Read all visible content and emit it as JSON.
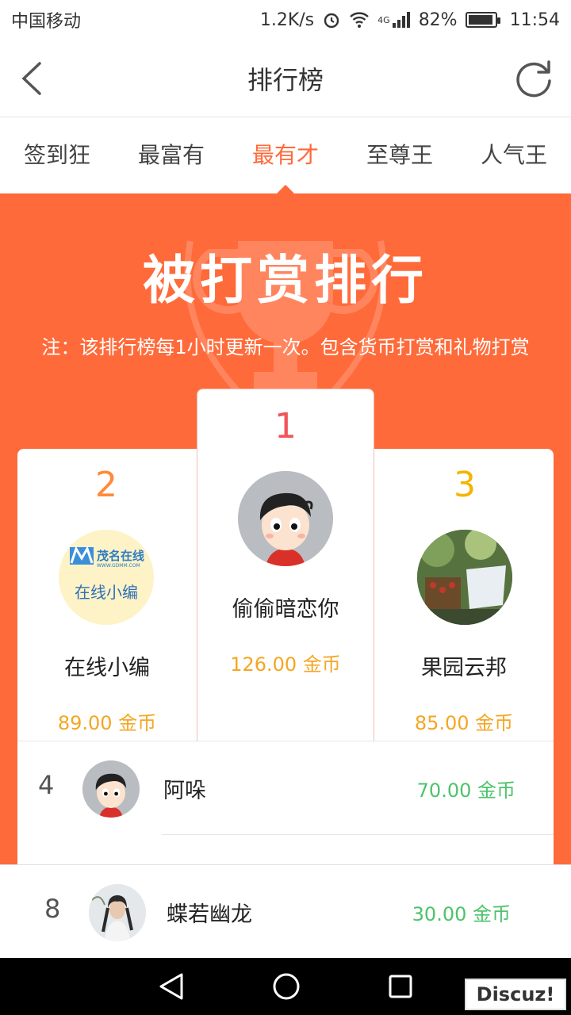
{
  "status_bar": {
    "carrier": "中国移动",
    "speed": "1.2K/s",
    "network": "4G",
    "battery": "82%",
    "battery_level": 0.82,
    "time": "11:54"
  },
  "header": {
    "title": "排行榜"
  },
  "tabs": [
    {
      "label": "签到狂",
      "active": false
    },
    {
      "label": "最富有",
      "active": false
    },
    {
      "label": "最有才",
      "active": true
    },
    {
      "label": "至尊王",
      "active": false
    },
    {
      "label": "人气王",
      "active": false
    }
  ],
  "banner": {
    "title": "被打赏排行",
    "note": "注：该排行榜每1小时更新一次。包含货币打赏和礼物打赏"
  },
  "podium": {
    "first": {
      "rank": "1",
      "name": "偷偷暗恋你",
      "score": "126.00 金币"
    },
    "second": {
      "rank": "2",
      "name": "在线小编",
      "score": "89.00 金币",
      "logo_text": "茂名在线",
      "logo_sub": "WWW.GDMM.COM",
      "logo_caption": "在线小编"
    },
    "third": {
      "rank": "3",
      "name": "果园云邦",
      "score": "85.00 金币"
    }
  },
  "list": [
    {
      "rank": "4",
      "name": "阿哚",
      "score": "70.00 金币"
    }
  ],
  "my_rank": {
    "rank": "8",
    "name": "蝶若幽龙",
    "score": "30.00 金币"
  },
  "watermark": "Discuz!",
  "colors": {
    "accent": "#ff6a3a",
    "gold": "#f5a623",
    "green": "#4cc36a",
    "rank1": "#f0555a",
    "rank2": "#ff8a3a",
    "rank3": "#f5b400"
  }
}
